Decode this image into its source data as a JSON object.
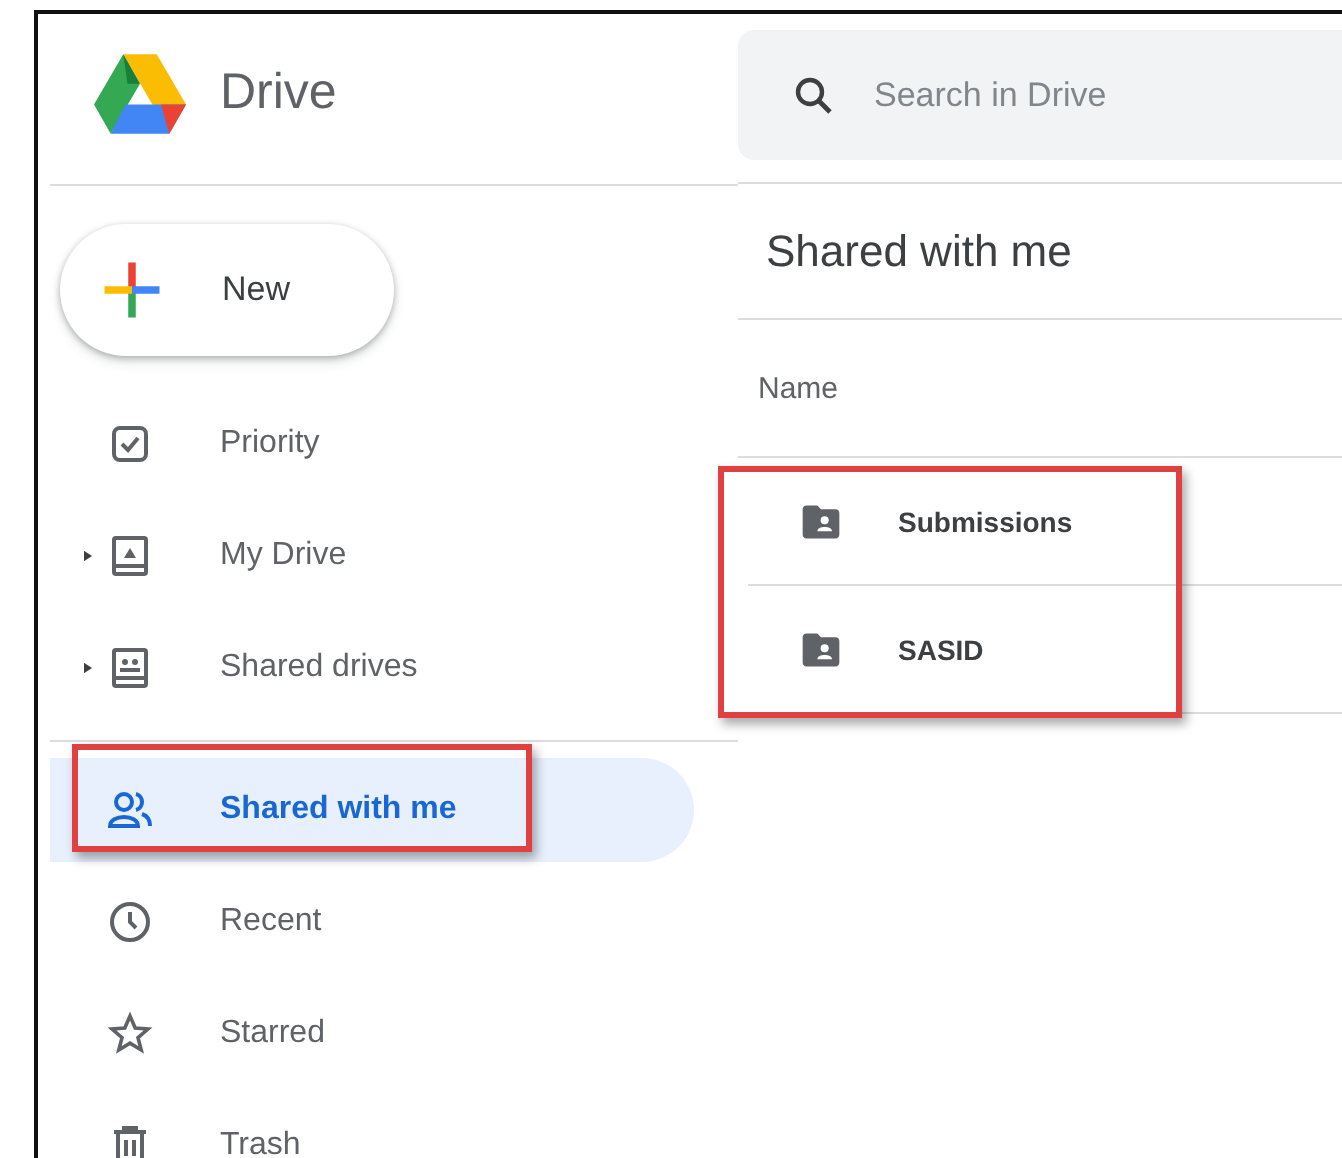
{
  "app": {
    "name": "Drive"
  },
  "search": {
    "placeholder": "Search in Drive"
  },
  "new_button": {
    "label": "New"
  },
  "sidebar": {
    "sections": [
      {
        "items": [
          {
            "label": "Priority",
            "expandable": false,
            "selected": false,
            "outlined": false
          },
          {
            "label": "My Drive",
            "expandable": true,
            "selected": false,
            "outlined": false
          },
          {
            "label": "Shared drives",
            "expandable": true,
            "selected": false,
            "outlined": false
          }
        ]
      },
      {
        "items": [
          {
            "label": "Shared with me",
            "expandable": false,
            "selected": true,
            "outlined": true
          },
          {
            "label": "Recent",
            "expandable": false,
            "selected": false,
            "outlined": false
          },
          {
            "label": "Starred",
            "expandable": false,
            "selected": false,
            "outlined": false
          },
          {
            "label": "Trash",
            "expandable": false,
            "selected": false,
            "outlined": false
          }
        ]
      }
    ]
  },
  "page_title": "Shared with me",
  "file_list": {
    "columns": [
      "Name"
    ],
    "outlined": true,
    "rows": [
      {
        "name": "Submissions"
      },
      {
        "name": "SASID"
      }
    ]
  }
}
